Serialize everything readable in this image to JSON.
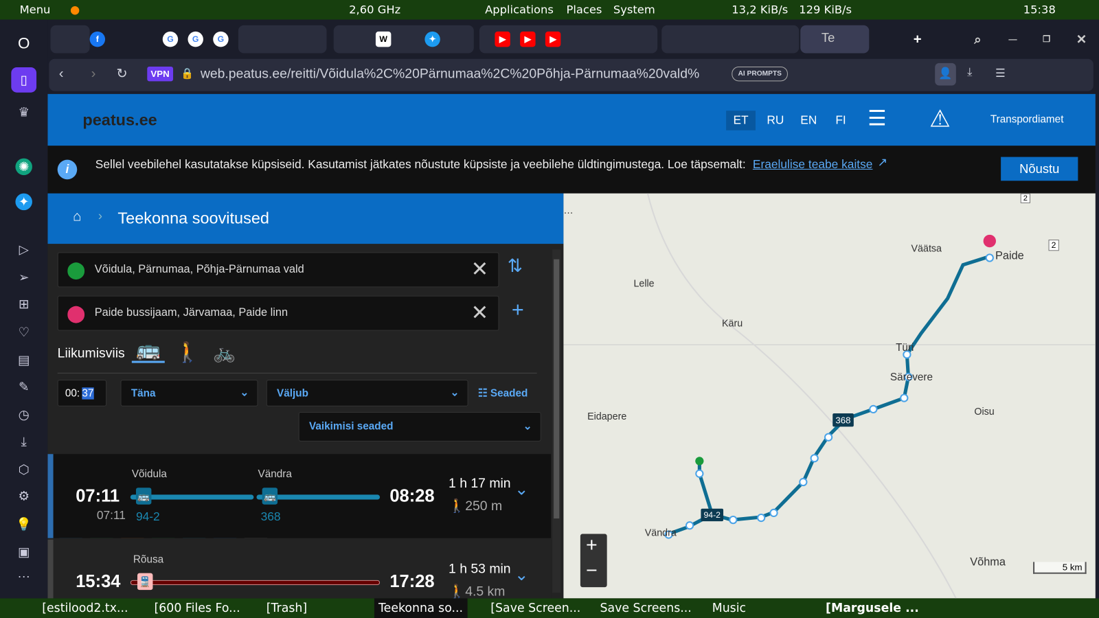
{
  "system_bar": {
    "menu": "Menu",
    "cpu": "2,60 GHz",
    "applications": "Applications",
    "places": "Places",
    "system": "System",
    "net": "13,2 KiB/s",
    "net_up": "129 KiB/s",
    "clock": "15:38"
  },
  "browser": {
    "url": "web.peatus.ee/reitti/Võidula%2C%20Pärnumaa%2C%20Põhja-Pärnumaa%20vald%",
    "vpn": "VPN",
    "ai_prompts": "AI PROMPTS",
    "tab_active_label": "Te"
  },
  "site": {
    "logo": "peatus.ee",
    "languages": [
      "ET",
      "RU",
      "EN",
      "FI"
    ],
    "transport_link": "Transpordiamet",
    "cookie": {
      "text": "Sellel veebilehel kasutatakse küpsiseid. Kasutamist jätkates nõustute küpsiste ja veebilehe üldtingimustega. Loe täpsemalt:",
      "link": "Eraelulise teabe kaitse",
      "accept": "Nõustu"
    },
    "page_title": "Teekonna soovitused",
    "origin": "Võidula, Pärnumaa, Põhja-Pärnumaa vald",
    "destination": "Paide bussijaam, Järvamaa, Paide linn",
    "mode_label": "Liikumisviis",
    "time_hours": "00:",
    "time_minutes": "37",
    "day": "Täna",
    "depart": "Väljub",
    "settings": "Seaded",
    "default_settings": "Vaikimisi seaded",
    "itineraries": [
      {
        "depart": "07:11",
        "depart_sub": "07:11",
        "arrive": "08:28",
        "duration": "1 h 17 min",
        "walk": "250 m",
        "legs": [
          {
            "stop": "Võidula",
            "route": "94-2"
          },
          {
            "stop": "Vändra",
            "route": "368"
          }
        ]
      },
      {
        "depart": "15:34",
        "arrive": "17:28",
        "duration": "1 h 53 min",
        "walk": "4.5 km",
        "legs": [
          {
            "stop": "Rõusa"
          }
        ]
      }
    ],
    "map": {
      "places": [
        "Väätsa",
        "Paide",
        "Lelle",
        "Käru",
        "Türi",
        "Särevere",
        "Oisu",
        "Eidapere",
        "Vändra",
        "Võhma"
      ],
      "route_badges": [
        "368",
        "94-2"
      ],
      "road_labels": [
        "2",
        "2"
      ],
      "scale": "5 km"
    }
  },
  "taskbar": [
    "[estilood2.tx...",
    "[600 Files Fo...",
    "[Trash]",
    "Teekonna so...",
    "[Save Screen...",
    "Save Screens...",
    "Music",
    "[Margusele ..."
  ],
  "colors": {
    "brand": "#0a6cc4",
    "route": "#0f6e93",
    "accept": "#0a6cc4"
  }
}
